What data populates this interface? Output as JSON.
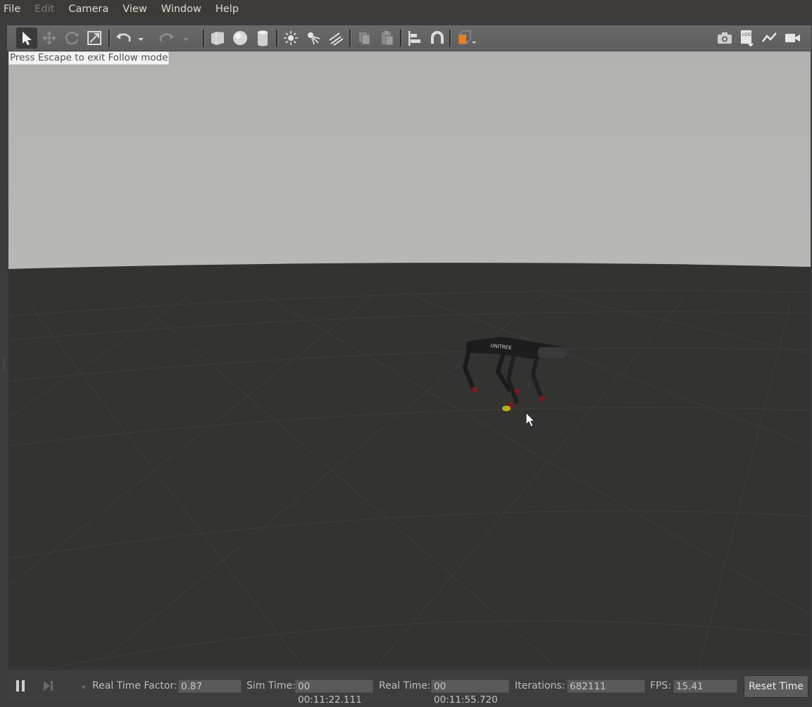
{
  "menu": {
    "items": [
      {
        "label": "File",
        "disabled": false
      },
      {
        "label": "Edit",
        "disabled": true
      },
      {
        "label": "Camera",
        "disabled": false
      },
      {
        "label": "View",
        "disabled": false
      },
      {
        "label": "Window",
        "disabled": false
      },
      {
        "label": "Help",
        "disabled": false
      }
    ]
  },
  "toolbar": {
    "icons": [
      "select-arrow-icon",
      "translate-icon",
      "rotate-icon",
      "scale-icon",
      "undo-icon",
      "undo-dropdown-icon",
      "redo-icon",
      "redo-dropdown-icon",
      "box-shape-icon",
      "sphere-shape-icon",
      "cylinder-shape-icon",
      "point-light-icon",
      "spot-light-icon",
      "directional-light-icon",
      "copy-icon",
      "paste-icon",
      "align-icon",
      "snap-magnet-icon",
      "view-angle-icon",
      "screenshot-icon",
      "log-icon",
      "plot-icon",
      "record-video-icon"
    ],
    "accent_color": "#f07d1c"
  },
  "viewport": {
    "follow_message": "Press Escape to exit Follow mode",
    "sky_color": "#b3b3b1",
    "ground_color": "#333332",
    "robot_logo_text": "UNITREE"
  },
  "status": {
    "real_time_factor_label": "Real Time Factor:",
    "real_time_factor_value": "0.87",
    "sim_time_label": "Sim Time:",
    "sim_time_value": "00 00:11:22.111",
    "real_time_label": "Real Time:",
    "real_time_value": "00 00:11:55.720",
    "iterations_label": "Iterations:",
    "iterations_value": "682111",
    "fps_label": "FPS:",
    "fps_value": "15.41",
    "reset_label": "Reset Time"
  }
}
